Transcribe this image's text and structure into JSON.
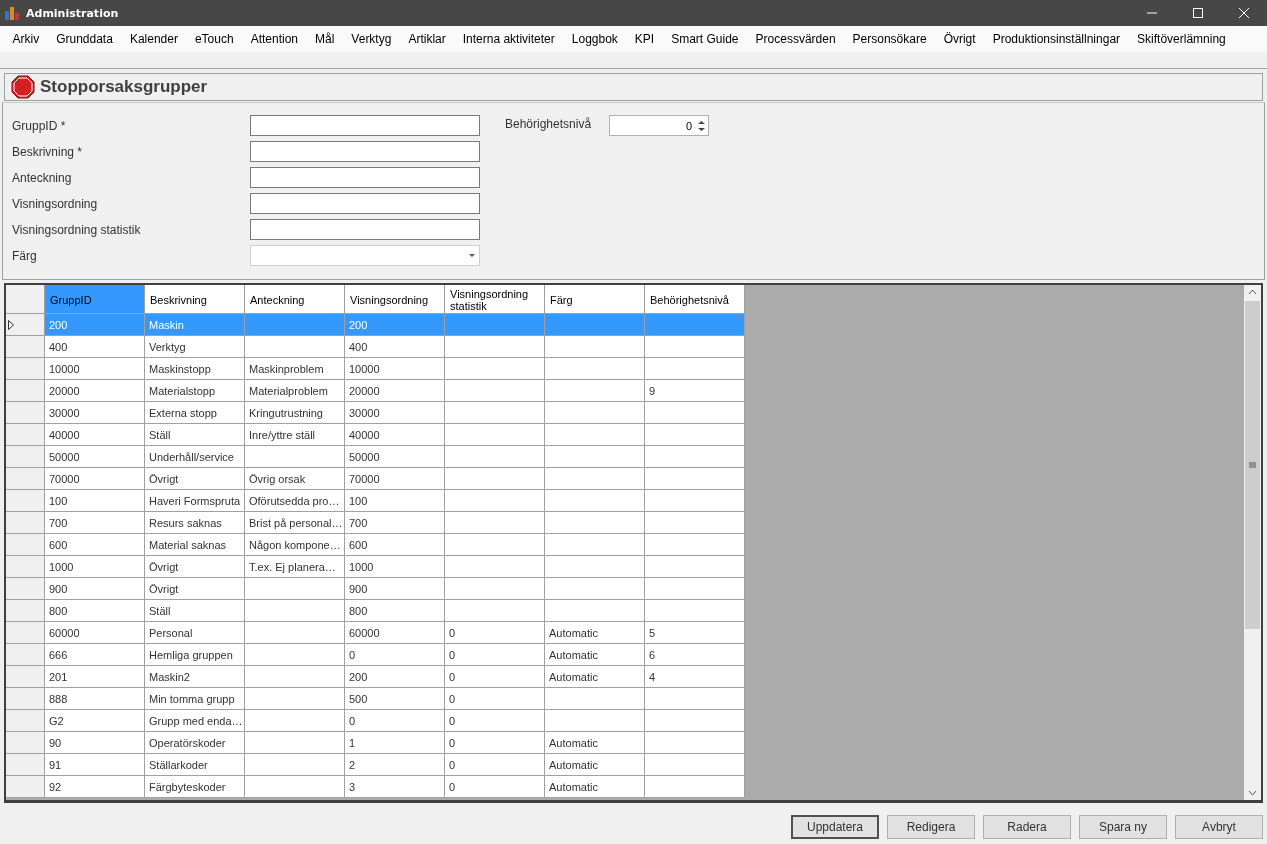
{
  "window": {
    "title": "Administration"
  },
  "menu": [
    "Arkiv",
    "Grunddata",
    "Kalender",
    "eTouch",
    "Attention",
    "Mål",
    "Verktyg",
    "Artiklar",
    "Interna aktiviteter",
    "Loggbok",
    "KPI",
    "Smart Guide",
    "Processvärden",
    "Personsökare",
    "Övrigt",
    "Produktionsinställningar",
    "Skiftöverlämning"
  ],
  "page_title": "Stopporsaksgrupper",
  "form": {
    "fields": [
      {
        "label": "GruppID *",
        "kind": "text"
      },
      {
        "label": "Beskrivning *",
        "kind": "text"
      },
      {
        "label": "Anteckning",
        "kind": "text"
      },
      {
        "label": "Visningsordning",
        "kind": "text"
      },
      {
        "label": "Visningsordning statistik",
        "kind": "text"
      },
      {
        "label": "Färg",
        "kind": "dropdown"
      }
    ],
    "spinner": {
      "label": "Behörighetsnivå",
      "value": "0"
    }
  },
  "table": {
    "columns": [
      {
        "label": "GruppID",
        "selected": true
      },
      {
        "label": "Beskrivning",
        "selected": false
      },
      {
        "label": "Anteckning",
        "selected": false
      },
      {
        "label": "Visningsordning",
        "selected": false
      },
      {
        "label": "Visningsordning statistik",
        "selected": false
      },
      {
        "label": "Färg",
        "selected": false
      },
      {
        "label": "Behörighetsnivå",
        "selected": false
      }
    ],
    "rows": [
      {
        "selected": true,
        "id": "200",
        "desc": "Maskin",
        "order": "200"
      },
      {
        "selected": false,
        "id": "400",
        "desc": "Verktyg",
        "order": "400"
      },
      {
        "selected": false,
        "id": "10000",
        "desc": "Maskinstopp",
        "note": "Maskinproblem",
        "order": "10000"
      },
      {
        "selected": false,
        "id": "20000",
        "desc": "Materialstopp",
        "note": "Materialproblem",
        "order": "20000",
        "level": "9"
      },
      {
        "selected": false,
        "id": "30000",
        "desc": "Externa stopp",
        "note": "Kringutrustning",
        "order": "30000"
      },
      {
        "selected": false,
        "id": "40000",
        "desc": "Ställ",
        "note": "Inre/yttre ställ",
        "order": "40000"
      },
      {
        "selected": false,
        "id": "50000",
        "desc": "Underhåll/service",
        "order": "50000"
      },
      {
        "selected": false,
        "id": "70000",
        "desc": "Övrigt",
        "note": "Övrig orsak",
        "order": "70000"
      },
      {
        "selected": false,
        "id": "100",
        "desc": "Haveri Formspruta",
        "note": "Oförutsedda pro…",
        "order": "100"
      },
      {
        "selected": false,
        "id": "700",
        "desc": "Resurs saknas",
        "note": "Brist på personal…",
        "order": "700"
      },
      {
        "selected": false,
        "id": "600",
        "desc": "Material saknas",
        "note": "Någon kompone…",
        "order": "600"
      },
      {
        "selected": false,
        "id": "1000",
        "desc": "Övrigt",
        "note": "T.ex. Ej planera…",
        "order": "1000"
      },
      {
        "selected": false,
        "id": "900",
        "desc": "Övrigt",
        "order": "900"
      },
      {
        "selected": false,
        "id": "800",
        "desc": "Ställ",
        "order": "800"
      },
      {
        "selected": false,
        "id": "60000",
        "desc": "Personal",
        "order": "60000",
        "stat": "0",
        "farg": "Automatic",
        "level": "5"
      },
      {
        "selected": false,
        "id": "666",
        "desc": "Hemliga gruppen",
        "order": "0",
        "stat": "0",
        "farg": "Automatic",
        "level": "6"
      },
      {
        "selected": false,
        "id": "201",
        "desc": "Maskin2",
        "order": "200",
        "stat": "0",
        "farg": "Automatic",
        "level": "4"
      },
      {
        "selected": false,
        "id": "888",
        "desc": "Min tomma grupp",
        "order": "500",
        "stat": "0"
      },
      {
        "selected": false,
        "id": "G2",
        "desc": "Grupp med enda…",
        "order": "0",
        "stat": "0"
      },
      {
        "selected": false,
        "id": "90",
        "desc": "Operatörskoder",
        "order": "1",
        "stat": "0",
        "farg": "Automatic"
      },
      {
        "selected": false,
        "id": "91",
        "desc": "Ställarkoder",
        "order": "2",
        "stat": "0",
        "farg": "Automatic"
      },
      {
        "selected": false,
        "id": "92",
        "desc": "Färgbyteskoder",
        "order": "3",
        "stat": "0",
        "farg": "Automatic"
      }
    ]
  },
  "buttons": [
    {
      "label": "Uppdatera",
      "selected": true
    },
    {
      "label": "Redigera",
      "selected": false
    },
    {
      "label": "Radera",
      "selected": false
    },
    {
      "label": "Spara ny",
      "selected": false
    },
    {
      "label": "Avbryt",
      "selected": false
    }
  ]
}
